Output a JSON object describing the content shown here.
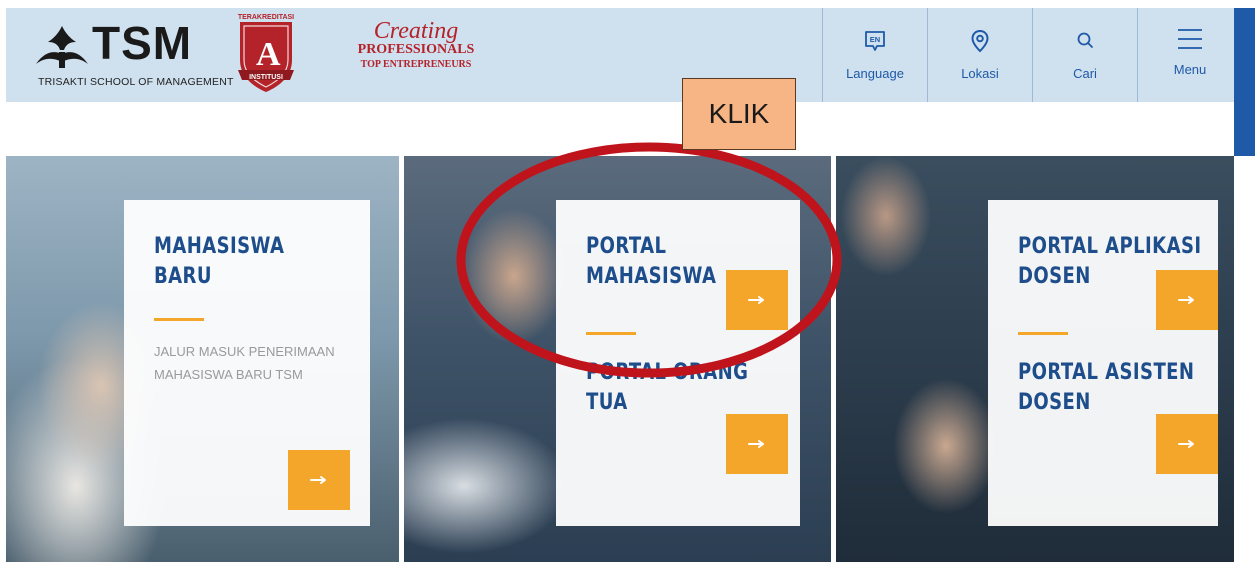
{
  "header": {
    "brand": "TSM",
    "brand_subtitle": "TRISAKTI SCHOOL OF MANAGEMENT",
    "badge": {
      "top_text": "TERAKREDITASI",
      "letter": "A",
      "bottom_text": "INSTITUSI"
    },
    "tagline": {
      "line1": "Creating",
      "line2": "PROFESSIONALS",
      "line3": "TOP ENTREPRENEURS"
    },
    "nav": [
      {
        "label": "Language",
        "icon": "language-icon",
        "icon_text": "EN"
      },
      {
        "label": "Lokasi",
        "icon": "location-pin-icon"
      },
      {
        "label": "Cari",
        "icon": "search-icon"
      },
      {
        "label": "Menu",
        "icon": "hamburger-menu-icon"
      }
    ]
  },
  "tiles": [
    {
      "sections": [
        {
          "title_lines": [
            "MAHASISWA",
            "BARU"
          ],
          "description_lines": [
            "JALUR MASUK PENERIMAAN",
            "MAHASISWA BARU TSM"
          ]
        }
      ]
    },
    {
      "sections": [
        {
          "title_lines": [
            "PORTAL",
            "MAHASISWA"
          ]
        },
        {
          "title_lines": [
            "PORTAL ORANG",
            "TUA"
          ]
        }
      ]
    },
    {
      "sections": [
        {
          "title_lines": [
            "PORTAL APLIKASI",
            "DOSEN"
          ]
        },
        {
          "title_lines": [
            "PORTAL ASISTEN",
            "DOSEN"
          ]
        }
      ]
    }
  ],
  "annotation": {
    "label": "KLIK",
    "highlight_color": "#c0141c",
    "label_bg": "#f7b585"
  },
  "colors": {
    "header_bg": "#cfe0ef",
    "accent": "#f4a62a",
    "brand_blue": "#1e4d8c",
    "brand_red": "#b4232a"
  }
}
